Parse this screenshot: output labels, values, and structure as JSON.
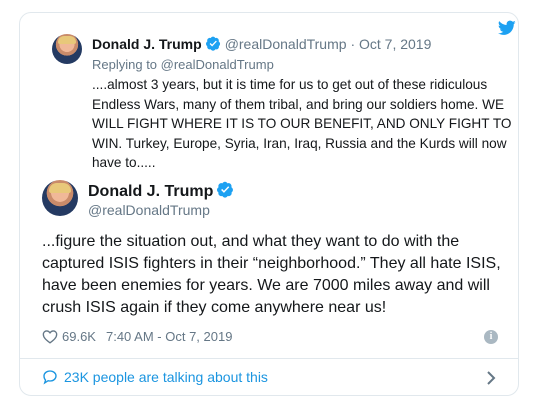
{
  "reply_tweet": {
    "author_name": "Donald J. Trump",
    "handle": "@realDonaldTrump",
    "separator": "·",
    "date": "Oct 7, 2019",
    "replying_to": "Replying to @realDonaldTrump",
    "text": "....almost 3 years, but it is time for us to get out of these ridiculous Endless Wars, many of them tribal, and bring our soldiers home. WE WILL FIGHT WHERE IT IS TO OUR BENEFIT, AND ONLY FIGHT TO WIN. Turkey, Europe, Syria, Iran, Iraq, Russia and the Kurds will now have to....."
  },
  "main_tweet": {
    "author_name": "Donald J. Trump",
    "handle": "@realDonaldTrump",
    "text": "...figure the situation out, and what they want to do with the captured ISIS fighters in their “neighborhood.” They all hate ISIS, have been enemies for years. We are 7000 miles away and will crush ISIS again if they come anywhere near us!",
    "likes": "69.6K",
    "timestamp": "7:40 AM - Oct 7, 2019"
  },
  "footer": {
    "talking_label": "23K people are talking about this"
  },
  "colors": {
    "link_blue": "#1b95e0",
    "twitter_blue": "#1da1f2",
    "muted_gray": "#657786",
    "border": "#e1e8ed"
  },
  "icons": [
    "twitter-bird-icon",
    "verified-badge-icon",
    "heart-icon",
    "info-icon",
    "speech-bubble-icon",
    "chevron-right-icon"
  ]
}
